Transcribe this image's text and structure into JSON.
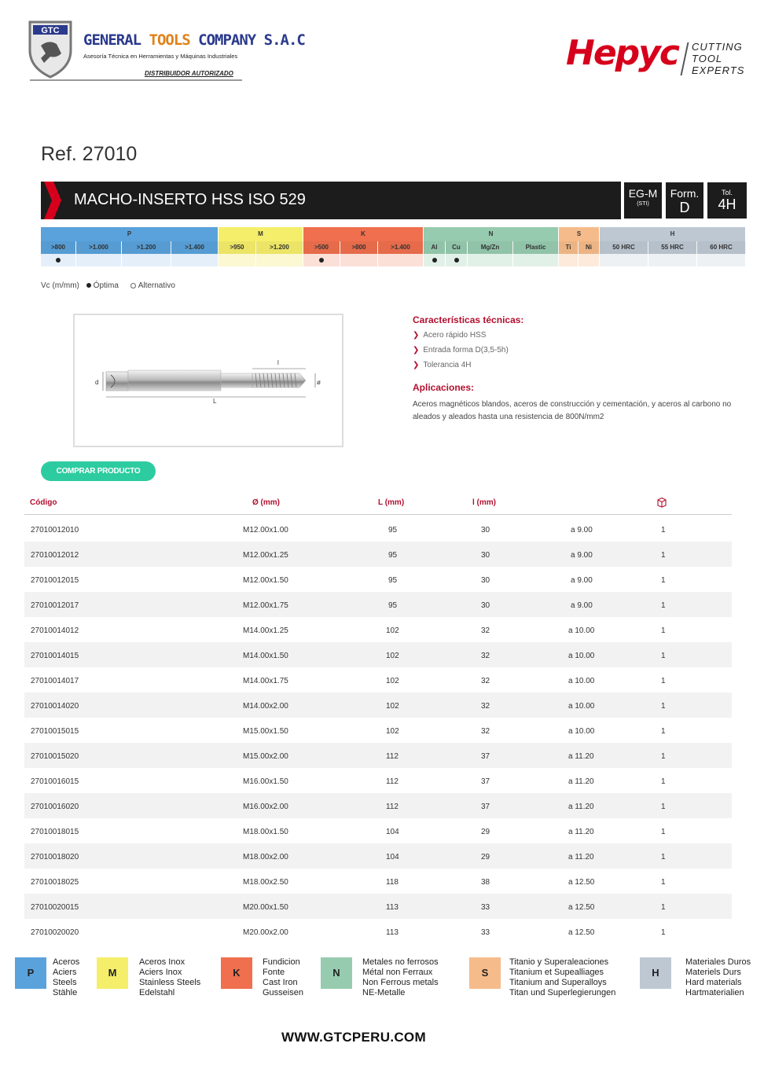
{
  "header": {
    "company_abbr": "GTC",
    "company_name_1": "GENERAL ",
    "company_name_2": "TOOLS",
    "company_name_3": " COMPANY S.A.C",
    "company_sub": "Asesoría Técnica en Herramientas y Máquinas Industriales",
    "distributor": "DISTRIBUIDOR AUTORIZADO",
    "brand": "Hepyc",
    "brand_tag": [
      "CUTTING",
      "TOOL",
      "EXPERTS"
    ]
  },
  "ref": "Ref. 27010",
  "title": "MACHO-INSERTO HSS ISO 529",
  "badges": {
    "thread": "EG-M",
    "thread_sub": "(STI)",
    "form_label": "Form.",
    "form_value": "D",
    "tol_label": "Tol.",
    "tol_value": "4H"
  },
  "materials": {
    "groups": [
      {
        "label": "P",
        "color": "#5aa2dc",
        "light": "#e4effa",
        "subs": [
          ">800",
          ">1.000",
          ">1.200",
          ">1.400"
        ],
        "dots": [
          true,
          false,
          false,
          false
        ]
      },
      {
        "label": "M",
        "color": "#f5ee6a",
        "light": "#fbf8d2",
        "subs": [
          ">950",
          ">1.200"
        ],
        "dots": [
          false,
          false
        ]
      },
      {
        "label": "K",
        "color": "#ef6f4e",
        "light": "#fbe0d8",
        "subs": [
          ">500",
          ">800",
          ">1.400"
        ],
        "dots": [
          true,
          false,
          false
        ]
      },
      {
        "label": "N",
        "color": "#97cbb0",
        "light": "#e2f1e8",
        "subs": [
          "Al",
          "Cu",
          "Mg/Zn",
          "Plastic"
        ],
        "dots": [
          true,
          true,
          false,
          false
        ]
      },
      {
        "label": "S",
        "color": "#f6bb8a",
        "light": "#fdeadb",
        "subs": [
          "Ti",
          "Ni"
        ],
        "dots": [
          false,
          false
        ]
      },
      {
        "label": "H",
        "color": "#bec8d2",
        "light": "#eef1f4",
        "subs": [
          "50 HRC",
          "55 HRC",
          "60 HRC"
        ],
        "dots": [
          false,
          false,
          false
        ]
      }
    ]
  },
  "legend": {
    "vc": "Vc (m/mm)",
    "optima": "Óptima",
    "alternativo": "Alternativo"
  },
  "drawing": {
    "dim_d": "d",
    "dim_L": "L",
    "dim_l": "l",
    "dim_o": "ø"
  },
  "characteristics": {
    "title": "Características técnicas:",
    "items": [
      "Acero rápido HSS",
      "Entrada forma D(3,5-5h)",
      "Tolerancia 4H"
    ],
    "arrow": "❯"
  },
  "applications": {
    "title": "Aplicaciones:",
    "text": "Aceros magnéticos blandos, aceros de construcción y cementación, y aceros al carbono no aleados y aleados hasta una resistencia de 800N/mm2"
  },
  "buy_button": "COMPRAR PRODUCTO",
  "table": {
    "headers": [
      "Código",
      "Ø (mm)",
      "L (mm)",
      "l (mm)",
      "",
      ""
    ],
    "rows": [
      [
        "27010012010",
        "M12.00x1.00",
        "95",
        "30",
        "a 9.00",
        "1"
      ],
      [
        "27010012012",
        "M12.00x1.25",
        "95",
        "30",
        "a 9.00",
        "1"
      ],
      [
        "27010012015",
        "M12.00x1.50",
        "95",
        "30",
        "a 9.00",
        "1"
      ],
      [
        "27010012017",
        "M12.00x1.75",
        "95",
        "30",
        "a 9.00",
        "1"
      ],
      [
        "27010014012",
        "M14.00x1.25",
        "102",
        "32",
        "a 10.00",
        "1"
      ],
      [
        "27010014015",
        "M14.00x1.50",
        "102",
        "32",
        "a 10.00",
        "1"
      ],
      [
        "27010014017",
        "M14.00x1.75",
        "102",
        "32",
        "a 10.00",
        "1"
      ],
      [
        "27010014020",
        "M14.00x2.00",
        "102",
        "32",
        "a 10.00",
        "1"
      ],
      [
        "27010015015",
        "M15.00x1.50",
        "102",
        "32",
        "a 10.00",
        "1"
      ],
      [
        "27010015020",
        "M15.00x2.00",
        "112",
        "37",
        "a 11.20",
        "1"
      ],
      [
        "27010016015",
        "M16.00x1.50",
        "112",
        "37",
        "a 11.20",
        "1"
      ],
      [
        "27010016020",
        "M16.00x2.00",
        "112",
        "37",
        "a 11.20",
        "1"
      ],
      [
        "27010018015",
        "M18.00x1.50",
        "104",
        "29",
        "a 11.20",
        "1"
      ],
      [
        "27010018020",
        "M18.00x2.00",
        "104",
        "29",
        "a 11.20",
        "1"
      ],
      [
        "27010018025",
        "M18.00x2.50",
        "118",
        "38",
        "a 12.50",
        "1"
      ],
      [
        "27010020015",
        "M20.00x1.50",
        "113",
        "33",
        "a 12.50",
        "1"
      ],
      [
        "27010020020",
        "M20.00x2.00",
        "113",
        "33",
        "a 12.50",
        "1"
      ]
    ]
  },
  "footer": {
    "items": [
      {
        "label": "P",
        "color": "#5aa2dc",
        "lines": [
          "Aceros",
          "Aciers",
          "Steels",
          "Stähle"
        ]
      },
      {
        "label": "M",
        "color": "#f5ee6a",
        "lines": [
          "Aceros Inox",
          "Aciers Inox",
          "Stainless Steels",
          "Edelstahl"
        ]
      },
      {
        "label": "K",
        "color": "#ef6f4e",
        "lines": [
          "Fundicion",
          "Fonte",
          "Cast Iron",
          "Gusseisen"
        ]
      },
      {
        "label": "N",
        "color": "#97cbb0",
        "lines": [
          "Metales no ferrosos",
          "Métal non Ferraux",
          "Non Ferrous metals",
          "NE-Metalle"
        ]
      },
      {
        "label": "S",
        "color": "#f6bb8a",
        "lines": [
          "Titanio y Superaleaciones",
          "Titanium et Supealliages",
          "Titanium and Superalloys",
          "Titan und Superlegierungen"
        ]
      },
      {
        "label": "H",
        "color": "#bec8d2",
        "lines": [
          "Materiales Duros",
          "Materiels Durs",
          "Hard materials",
          "Hartmaterialien"
        ]
      }
    ],
    "website": "WWW.GTCPERU.COM"
  }
}
